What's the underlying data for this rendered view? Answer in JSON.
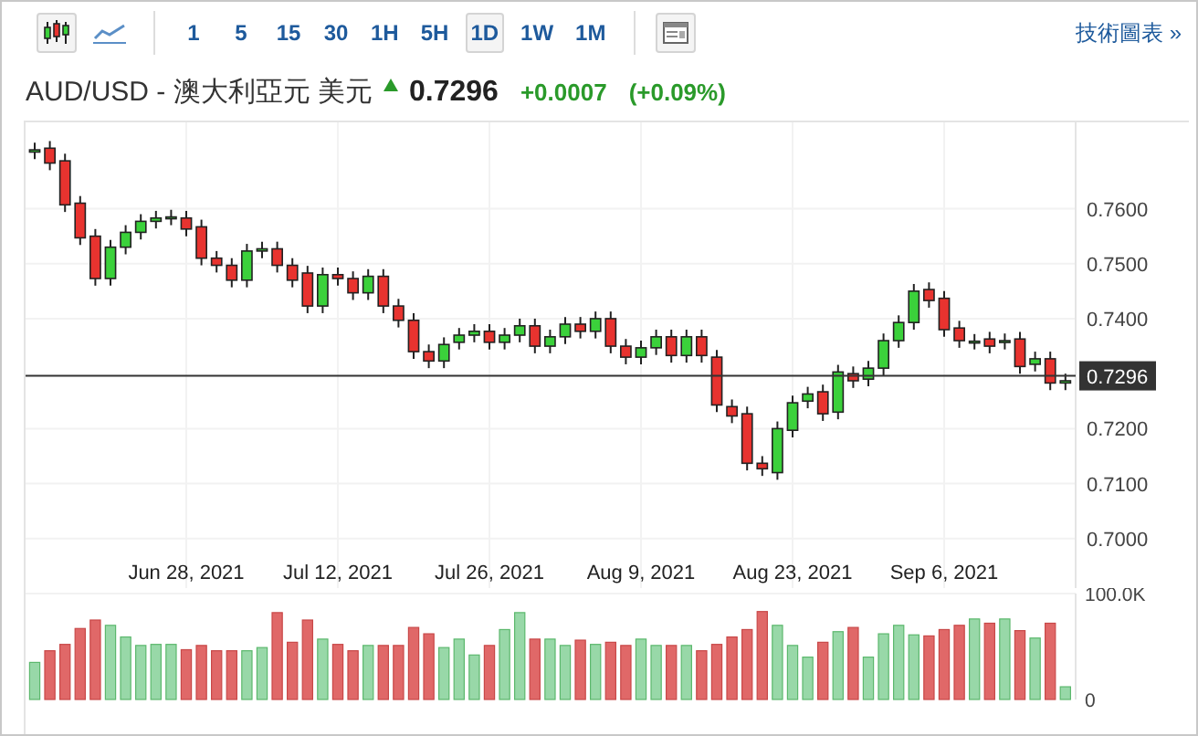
{
  "toolbar": {
    "chart_types": [
      {
        "kind": "candlestick",
        "selected": true
      },
      {
        "kind": "line",
        "selected": false
      }
    ],
    "intervals": [
      {
        "label": "1",
        "selected": false
      },
      {
        "label": "5",
        "selected": false
      },
      {
        "label": "15",
        "selected": false
      },
      {
        "label": "30",
        "selected": false
      },
      {
        "label": "1H",
        "selected": false
      },
      {
        "label": "5H",
        "selected": false
      },
      {
        "label": "1D",
        "selected": true
      },
      {
        "label": "1W",
        "selected": false
      },
      {
        "label": "1M",
        "selected": false
      }
    ],
    "link": "技術圖表 »"
  },
  "quote": {
    "title": "AUD/USD - 澳大利亞元 美元",
    "rising": true,
    "price": "0.7296",
    "change": "+0.0007",
    "change_percent": "(+0.09%)"
  },
  "price_chart": {
    "chart_data": {
      "type": "candlestick",
      "grid": true,
      "ylim": [
        0.691,
        0.7757
      ],
      "yticks": [
        {
          "value": 0.76,
          "label": "0.7600"
        },
        {
          "value": 0.75,
          "label": "0.7500"
        },
        {
          "value": 0.74,
          "label": "0.7400"
        },
        {
          "value": 0.72,
          "label": "0.7200"
        },
        {
          "value": 0.71,
          "label": "0.7100"
        },
        {
          "value": 0.7,
          "label": "0.7000"
        }
      ],
      "ref_lines": [
        {
          "axis": "y",
          "value": 0.7296,
          "label": "0.7296"
        }
      ],
      "categories": [
        null,
        null,
        null,
        null,
        null,
        null,
        null,
        null,
        null,
        null,
        "Jun 28, 2021",
        null,
        null,
        null,
        null,
        null,
        null,
        null,
        null,
        null,
        "Jul 12, 2021",
        null,
        null,
        null,
        null,
        null,
        null,
        null,
        null,
        null,
        "Jul 26, 2021",
        null,
        null,
        null,
        null,
        null,
        null,
        null,
        null,
        null,
        "Aug 9, 2021",
        null,
        null,
        null,
        null,
        null,
        null,
        null,
        null,
        null,
        "Aug 23, 2021",
        null,
        null,
        null,
        null,
        null,
        null,
        null,
        null,
        null,
        "Sep 6, 2021",
        null,
        null,
        null,
        null,
        null,
        null,
        null,
        null
      ],
      "ohlc": [
        [
          0.7703,
          0.772,
          0.769,
          0.7707
        ],
        [
          0.771,
          0.7723,
          0.767,
          0.7683
        ],
        [
          0.7687,
          0.77,
          0.7594,
          0.7607
        ],
        [
          0.761,
          0.7623,
          0.7534,
          0.7547
        ],
        [
          0.755,
          0.7563,
          0.746,
          0.7473
        ],
        [
          0.7473,
          0.7543,
          0.746,
          0.753
        ],
        [
          0.753,
          0.757,
          0.7517,
          0.7557
        ],
        [
          0.7557,
          0.759,
          0.7544,
          0.7577
        ],
        [
          0.7577,
          0.7596,
          0.7564,
          0.7583
        ],
        [
          0.7583,
          0.7598,
          0.757,
          0.7585
        ],
        [
          0.7583,
          0.7596,
          0.755,
          0.7563
        ],
        [
          0.7567,
          0.758,
          0.7497,
          0.751
        ],
        [
          0.751,
          0.7523,
          0.7484,
          0.7497
        ],
        [
          0.7497,
          0.751,
          0.7457,
          0.747
        ],
        [
          0.747,
          0.7536,
          0.7457,
          0.7523
        ],
        [
          0.7523,
          0.754,
          0.751,
          0.7527
        ],
        [
          0.7527,
          0.754,
          0.7484,
          0.7497
        ],
        [
          0.7497,
          0.751,
          0.7457,
          0.747
        ],
        [
          0.7483,
          0.7496,
          0.741,
          0.7423
        ],
        [
          0.7423,
          0.7493,
          0.741,
          0.748
        ],
        [
          0.748,
          0.7493,
          0.746,
          0.7473
        ],
        [
          0.7473,
          0.7486,
          0.7434,
          0.7447
        ],
        [
          0.7447,
          0.749,
          0.7434,
          0.7477
        ],
        [
          0.7477,
          0.749,
          0.741,
          0.7423
        ],
        [
          0.7423,
          0.7436,
          0.7384,
          0.7397
        ],
        [
          0.7397,
          0.741,
          0.7327,
          0.734
        ],
        [
          0.734,
          0.7353,
          0.731,
          0.7323
        ],
        [
          0.7323,
          0.7366,
          0.731,
          0.7353
        ],
        [
          0.7357,
          0.7383,
          0.7344,
          0.737
        ],
        [
          0.737,
          0.739,
          0.7357,
          0.7377
        ],
        [
          0.7377,
          0.739,
          0.7344,
          0.7357
        ],
        [
          0.7357,
          0.7383,
          0.7344,
          0.737
        ],
        [
          0.737,
          0.74,
          0.7357,
          0.7387
        ],
        [
          0.7387,
          0.74,
          0.7337,
          0.735
        ],
        [
          0.735,
          0.738,
          0.7337,
          0.7367
        ],
        [
          0.7367,
          0.7403,
          0.7354,
          0.739
        ],
        [
          0.739,
          0.7403,
          0.7364,
          0.7377
        ],
        [
          0.7377,
          0.7413,
          0.7364,
          0.74
        ],
        [
          0.74,
          0.7413,
          0.7337,
          0.735
        ],
        [
          0.735,
          0.7363,
          0.7317,
          0.733
        ],
        [
          0.733,
          0.736,
          0.7317,
          0.7347
        ],
        [
          0.7347,
          0.738,
          0.7334,
          0.7367
        ],
        [
          0.7367,
          0.738,
          0.732,
          0.7333
        ],
        [
          0.7333,
          0.738,
          0.732,
          0.7367
        ],
        [
          0.7367,
          0.738,
          0.732,
          0.7333
        ],
        [
          0.733,
          0.7343,
          0.723,
          0.7243
        ],
        [
          0.724,
          0.7253,
          0.721,
          0.7223
        ],
        [
          0.7227,
          0.724,
          0.7124,
          0.7137
        ],
        [
          0.7137,
          0.715,
          0.7114,
          0.7127
        ],
        [
          0.712,
          0.7213,
          0.7107,
          0.72
        ],
        [
          0.7197,
          0.726,
          0.7184,
          0.7247
        ],
        [
          0.725,
          0.7276,
          0.7237,
          0.7263
        ],
        [
          0.7267,
          0.728,
          0.7214,
          0.7227
        ],
        [
          0.723,
          0.7316,
          0.7217,
          0.7303
        ],
        [
          0.73,
          0.7313,
          0.7274,
          0.7287
        ],
        [
          0.729,
          0.7323,
          0.7277,
          0.731
        ],
        [
          0.731,
          0.7373,
          0.7297,
          0.736
        ],
        [
          0.736,
          0.7406,
          0.7347,
          0.7393
        ],
        [
          0.7393,
          0.7463,
          0.738,
          0.745
        ],
        [
          0.7453,
          0.7466,
          0.742,
          0.7433
        ],
        [
          0.7437,
          0.745,
          0.7367,
          0.738
        ],
        [
          0.7383,
          0.7396,
          0.7347,
          0.736
        ],
        [
          0.7357,
          0.7372,
          0.7344,
          0.7359
        ],
        [
          0.7363,
          0.7376,
          0.7337,
          0.735
        ],
        [
          0.7357,
          0.7373,
          0.7344,
          0.736
        ],
        [
          0.7363,
          0.7376,
          0.73,
          0.7313
        ],
        [
          0.7317,
          0.734,
          0.7304,
          0.7327
        ],
        [
          0.7327,
          0.734,
          0.727,
          0.7283
        ],
        [
          0.7283,
          0.73,
          0.727,
          0.7287
        ]
      ]
    }
  },
  "volume_chart": {
    "chart_data": {
      "type": "bar",
      "ylim": [
        0,
        100000
      ],
      "yticks": [
        {
          "value": 0,
          "label": "0"
        },
        {
          "value": 100000,
          "label": "100.0K"
        }
      ],
      "values": [
        35000,
        46000,
        52000,
        67000,
        75000,
        70000,
        59000,
        51000,
        52000,
        52000,
        47000,
        51000,
        46000,
        46000,
        46000,
        49000,
        82000,
        54000,
        75000,
        57000,
        52000,
        46000,
        51000,
        51000,
        51000,
        68000,
        62000,
        49000,
        57000,
        42000,
        51000,
        66000,
        82000,
        57000,
        57000,
        51000,
        56000,
        52000,
        54000,
        51000,
        57000,
        51000,
        51000,
        51000,
        46000,
        52000,
        59000,
        66000,
        83000,
        70000,
        51000,
        40000,
        54000,
        64000,
        68000,
        40000,
        62000,
        70000,
        61000,
        60000,
        66000,
        70000,
        76000,
        72000,
        76000,
        65000,
        58000,
        72000,
        12000
      ]
    }
  }
}
